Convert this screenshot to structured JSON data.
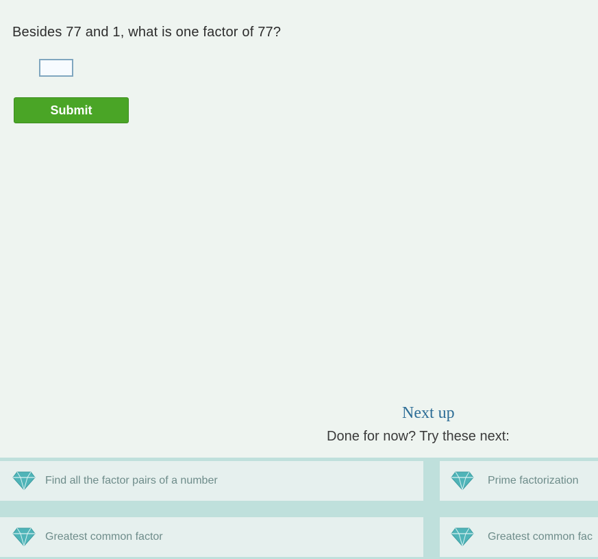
{
  "question": {
    "text": "Besides 77 and 1, what is one factor of 77?"
  },
  "answer": {
    "value": ""
  },
  "submit": {
    "label": "Submit"
  },
  "next_up": {
    "title": "Next up",
    "subtitle": "Done for now? Try these next:",
    "skills": [
      {
        "label": "Find all the factor pairs of a number",
        "icon": "diamond-icon"
      },
      {
        "label": "Prime factorization",
        "icon": "diamond-icon"
      },
      {
        "label": "Greatest common factor",
        "icon": "diamond-icon"
      },
      {
        "label": "Greatest common fac",
        "icon": "diamond-icon"
      }
    ]
  },
  "colors": {
    "submit": "#4aa526",
    "link": "#2d6d96",
    "band": "#bfe0dc",
    "diamond": "#4fb4b8"
  }
}
